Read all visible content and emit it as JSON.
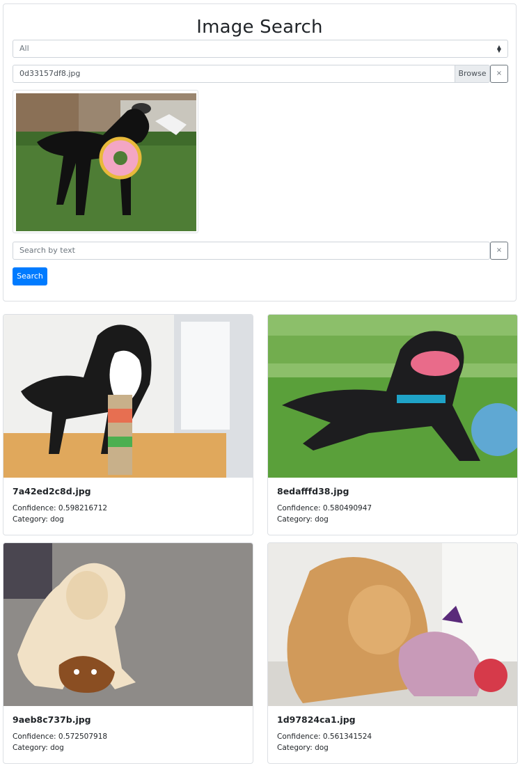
{
  "header": {
    "title": "Image Search"
  },
  "filter": {
    "selected": "All"
  },
  "upload": {
    "file_name": "0d33157df8.jpg",
    "browse_label": "Browse",
    "clear_label": "×"
  },
  "query": {
    "placeholder": "Search by text",
    "clear_label": "×"
  },
  "search_button": {
    "label": "Search"
  },
  "results": [
    {
      "file_name": "7a42ed2c8d.jpg",
      "confidence": "Confidence: 0.598216712",
      "category": "Category: dog"
    },
    {
      "file_name": "8edafffd38.jpg",
      "confidence": "Confidence: 0.580490947",
      "category": "Category: dog"
    },
    {
      "file_name": "9aeb8c737b.jpg",
      "confidence": "Confidence: 0.572507918",
      "category": "Category: dog"
    },
    {
      "file_name": "1d97824ca1.jpg",
      "confidence": "Confidence: 0.561341524",
      "category": "Category: dog"
    }
  ],
  "colors": {
    "primary": "#007bff",
    "border": "#ced4da"
  }
}
